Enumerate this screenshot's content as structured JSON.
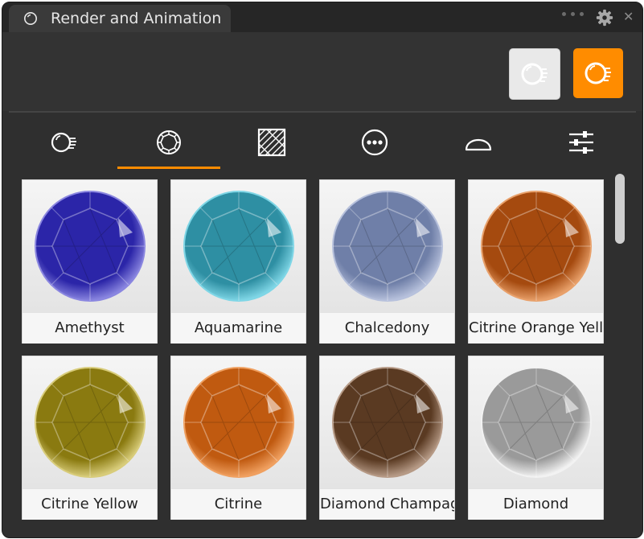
{
  "window": {
    "title": "Render and Animation",
    "icon": "render-app-icon"
  },
  "titlebar": {
    "icons": [
      "more-dots-icon",
      "gear-icon",
      "close-icon"
    ],
    "close_glyph": "✕"
  },
  "toolbar": {
    "buttons": [
      {
        "name": "static-render-button",
        "icon": "render-sphere-icon",
        "active": false
      },
      {
        "name": "animation-render-button",
        "icon": "render-sphere-icon",
        "active": true
      }
    ]
  },
  "categories": [
    {
      "name": "render-sphere",
      "icon": "render-sphere-icon",
      "active": false
    },
    {
      "name": "gemstone",
      "icon": "gem-icon",
      "active": true
    },
    {
      "name": "texture",
      "icon": "texture-icon",
      "active": false
    },
    {
      "name": "more",
      "icon": "more-circle-icon",
      "active": false
    },
    {
      "name": "dome",
      "icon": "dome-icon",
      "active": false
    },
    {
      "name": "settings",
      "icon": "sliders-icon",
      "active": false
    }
  ],
  "colors": {
    "accent": "#ff8c00",
    "panel": "#2f2f2f",
    "titlebar": "#262626"
  },
  "materials": [
    {
      "label": "Amethyst",
      "color": "#2b25a8",
      "rim": "#8a86e0"
    },
    {
      "label": "Aquamarine",
      "color": "#2e8fa3",
      "rim": "#7fd6e6"
    },
    {
      "label": "Chalcedony",
      "color": "#6f7fa8",
      "rim": "#b7c1dc"
    },
    {
      "label": "Citrine Orange Yellow",
      "color": "#a54a0f",
      "rim": "#e8a06a"
    },
    {
      "label": "Citrine Yellow",
      "color": "#8a7a10",
      "rim": "#d8cc7a"
    },
    {
      "label": "Citrine",
      "color": "#c05a10",
      "rim": "#f0a060"
    },
    {
      "label": "Diamond Champagne",
      "color": "#5a3a22",
      "rim": "#b69a86"
    },
    {
      "label": "Diamond",
      "color": "#9a9a9a",
      "rim": "#f2f2f2"
    }
  ]
}
